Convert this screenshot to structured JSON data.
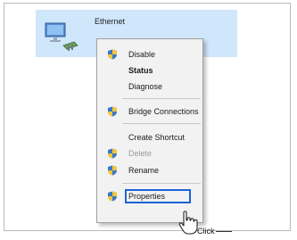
{
  "adapter": {
    "name": "Ethernet",
    "icon": "network-adapter-icon"
  },
  "menu": {
    "items": [
      {
        "label": "Disable",
        "icon": "shield-icon",
        "style": "normal"
      },
      {
        "label": "Status",
        "style": "bold"
      },
      {
        "label": "Diagnose",
        "style": "normal"
      },
      {
        "label": "Bridge Connections",
        "icon": "shield-icon",
        "style": "normal"
      },
      {
        "label": "Create Shortcut",
        "style": "normal"
      },
      {
        "label": "Delete",
        "icon": "shield-icon",
        "style": "disabled"
      },
      {
        "label": "Rename",
        "icon": "shield-icon",
        "style": "normal"
      },
      {
        "label": "Properties",
        "icon": "shield-icon",
        "style": "highlighted"
      }
    ]
  },
  "annotation": {
    "click_label": "Click"
  },
  "colors": {
    "selection": "#cfe6fb",
    "highlight": "#1d63d6",
    "menu_bg": "#f2f2f2"
  }
}
